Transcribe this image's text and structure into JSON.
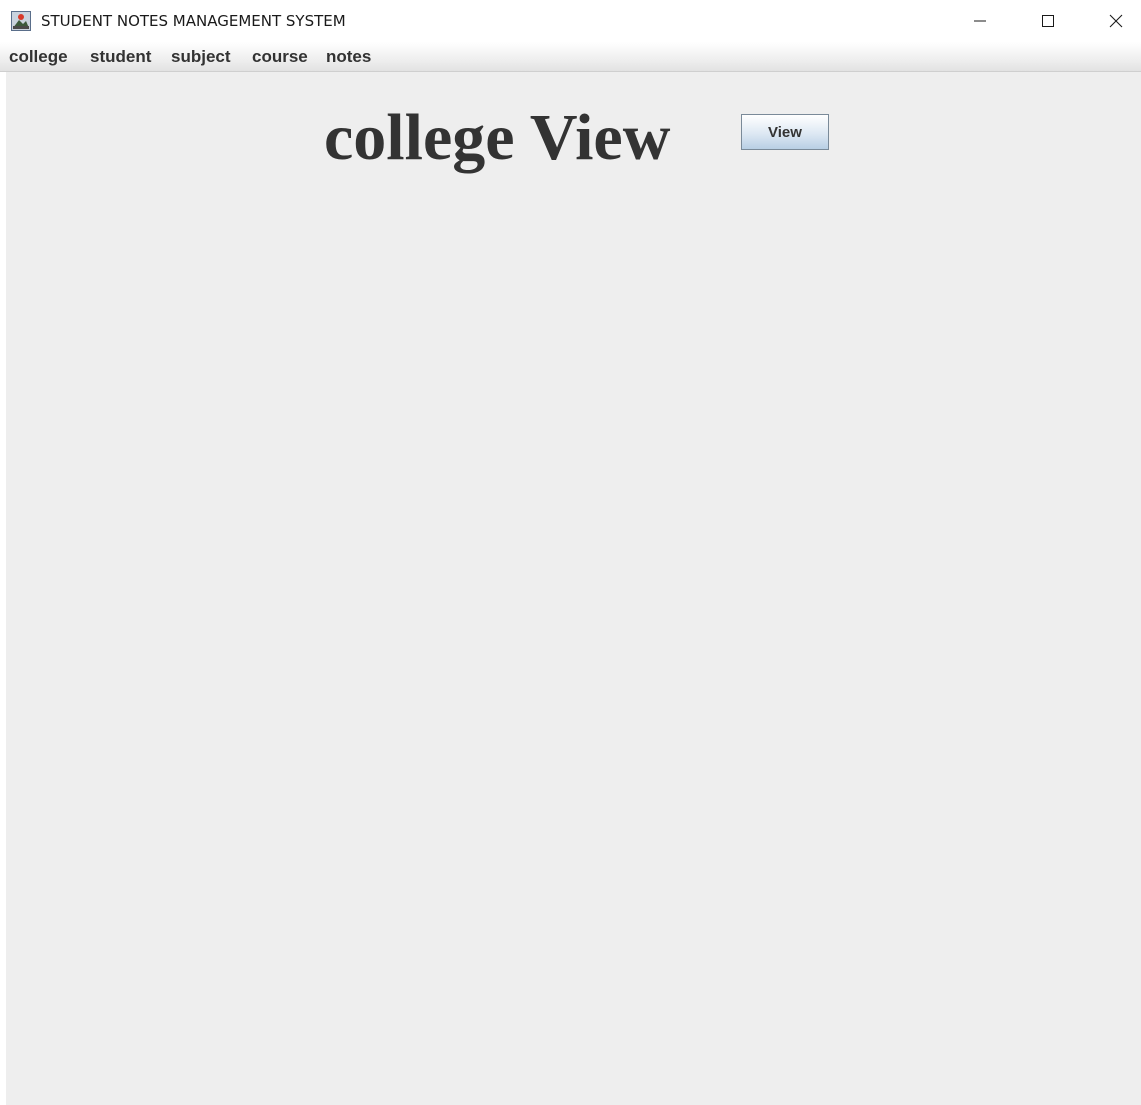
{
  "window": {
    "title": "STUDENT NOTES MANAGEMENT SYSTEM",
    "icon": "java-app-icon",
    "controls": [
      "minimize-icon",
      "maximize-icon",
      "close-icon"
    ]
  },
  "menubar": {
    "items": [
      {
        "label": "college"
      },
      {
        "label": "student"
      },
      {
        "label": "subject"
      },
      {
        "label": "course"
      },
      {
        "label": "notes"
      }
    ]
  },
  "main": {
    "heading": "college View",
    "view_button_label": "View"
  },
  "colors": {
    "content_background": "#eeeeee",
    "text": "#333333",
    "button_gradient_bottom": "#b8cfe5"
  }
}
